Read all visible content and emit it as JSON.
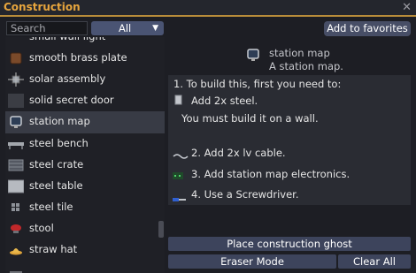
{
  "window": {
    "title": "Construction",
    "close_glyph": "✕"
  },
  "search": {
    "placeholder": "Search",
    "value": ""
  },
  "category": {
    "selected": "All",
    "arrow": "▼"
  },
  "items": [
    {
      "name": "small wall light",
      "icon": "wall-light-icon"
    },
    {
      "name": "smooth brass plate",
      "icon": "brass-plate-icon"
    },
    {
      "name": "solar assembly",
      "icon": "solar-assembly-icon"
    },
    {
      "name": "solid secret door",
      "icon": "secret-door-icon"
    },
    {
      "name": "station map",
      "icon": "station-map-icon",
      "selected": true
    },
    {
      "name": "steel bench",
      "icon": "bench-icon"
    },
    {
      "name": "steel crate",
      "icon": "crate-icon"
    },
    {
      "name": "steel table",
      "icon": "table-icon"
    },
    {
      "name": "steel tile",
      "icon": "tile-icon"
    },
    {
      "name": "stool",
      "icon": "stool-icon"
    },
    {
      "name": "straw hat",
      "icon": "straw-hat-icon"
    }
  ],
  "detail": {
    "favorites_label": "Add to favorites",
    "name": "station map",
    "description": "A station map.",
    "steps": {
      "intro": "1. To build this, first you need to:",
      "material": "Add 2x steel.",
      "note": "You must build it on a wall.",
      "step2": "2. Add 2x lv cable.",
      "step3": "3. Add station map electronics.",
      "step4": "4. Use a Screwdriver."
    }
  },
  "buttons": {
    "ghost": "Place construction ghost",
    "eraser": "Eraser Mode",
    "clear": "Clear All"
  },
  "colors": {
    "accent": "#e7a53d",
    "button": "#3d445c",
    "selected_row": "#383b45"
  }
}
